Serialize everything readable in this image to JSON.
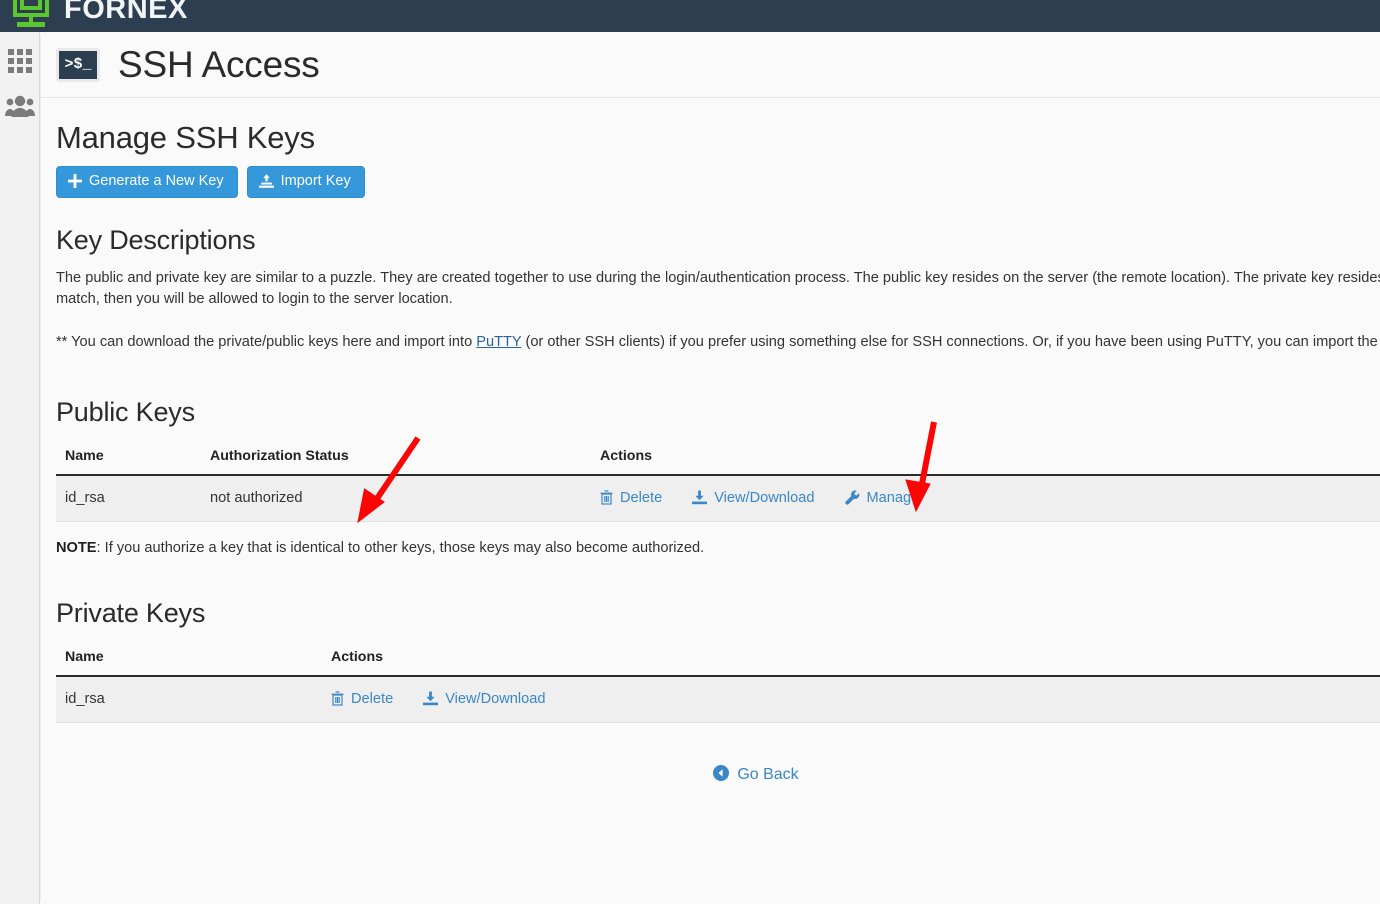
{
  "topbar": {
    "brand_name": "FORNEX",
    "logo_icon": "fornex-logo-icon",
    "bg_color": "#2c3e50",
    "logo_color": "#5ac72e"
  },
  "rail": {
    "items": [
      {
        "icon": "grid-apps-icon",
        "name": "apps"
      },
      {
        "icon": "users-group-icon",
        "name": "users"
      }
    ]
  },
  "page": {
    "icon": "terminal-icon",
    "icon_glyph": ">$_",
    "title": "SSH Access"
  },
  "manage": {
    "heading": "Manage SSH Keys",
    "buttons": [
      {
        "label": "Generate a New Key",
        "icon": "plus-icon"
      },
      {
        "label": "Import Key",
        "icon": "upload-icon"
      }
    ],
    "accent_color": "#3498db"
  },
  "descriptions": {
    "heading": "Key Descriptions",
    "paragraph1": "The public and private key are similar to a puzzle. They are created together to use during the login/authentication process. The public key resides on the server (the remote location). The private key resides on your computer/server. When you attempt to login to a server, the public and private key are compared. If they match, then you will be allowed to login to the server location.",
    "paragraph2_pre": "** You can download the private/public keys here and import into ",
    "paragraph2_link": "PuTTY",
    "paragraph2_post": " (or other SSH clients) if you prefer using something else for SSH connections. Or, if you have been using PuTTY, you can import the keys by clicking on Import Key. You can also download your key in PuTTY's ppk format under View/Download."
  },
  "public_keys": {
    "heading": "Public Keys",
    "columns": [
      "Name",
      "Authorization Status",
      "Actions"
    ],
    "rows": [
      {
        "name": "id_rsa",
        "status": "not authorized",
        "actions": [
          {
            "label": "Delete",
            "icon": "trash-icon"
          },
          {
            "label": "View/Download",
            "icon": "download-icon"
          },
          {
            "label": "Manage",
            "icon": "wrench-icon"
          }
        ]
      }
    ],
    "note_bold": "NOTE",
    "note_text": ": If you authorize a key that is identical to other keys, those keys may also become authorized."
  },
  "private_keys": {
    "heading": "Private Keys",
    "columns": [
      "Name",
      "Actions"
    ],
    "rows": [
      {
        "name": "id_rsa",
        "actions": [
          {
            "label": "Delete",
            "icon": "trash-icon"
          },
          {
            "label": "View/Download",
            "icon": "download-icon"
          }
        ]
      }
    ]
  },
  "footer": {
    "go_back_label": "Go Back",
    "go_back_icon": "arrow-circle-left-icon"
  },
  "annotations": {
    "color": "#fb0505",
    "arrows": [
      {
        "name": "arrow-pointing-authorization-status",
        "target": "authorization-status-cell"
      },
      {
        "name": "arrow-pointing-manage-link",
        "target": "manage-link"
      }
    ]
  }
}
